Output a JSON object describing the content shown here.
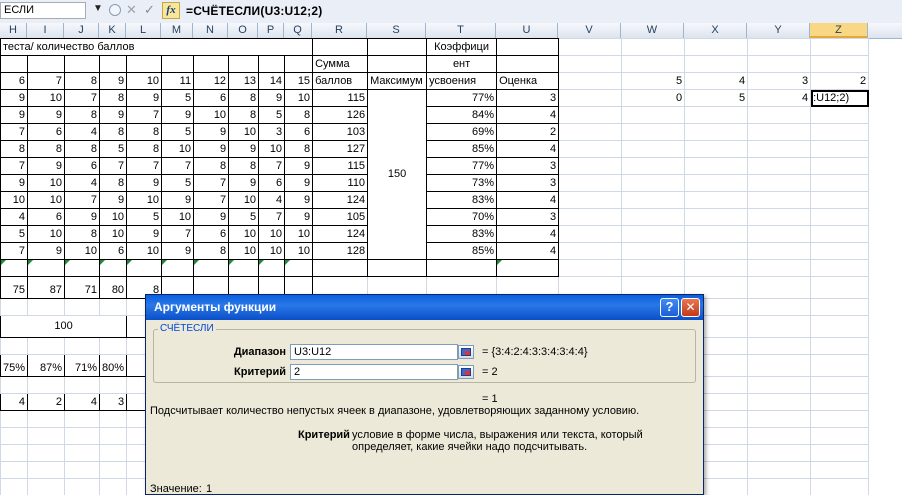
{
  "formula_bar": {
    "name_box": "ЕСЛИ",
    "formula": "=СЧЁТЕСЛИ(U3:U12;2)",
    "fx_label": "fx",
    "cancel_glyph": "✕",
    "enter_glyph": "✓"
  },
  "columns": [
    "H",
    "I",
    "J",
    "K",
    "L",
    "M",
    "N",
    "O",
    "P",
    "Q",
    "R",
    "S",
    "T",
    "U",
    "V",
    "W",
    "X",
    "Y",
    "Z"
  ],
  "selected_column": "Z",
  "sheet": {
    "header_text": "теста/ количество баллов",
    "numbers_row": [
      "6",
      "7",
      "8",
      "9",
      "10",
      "11",
      "12",
      "13",
      "14",
      "15"
    ],
    "sum_header_top": "Сумма",
    "sum_header_bottom": "баллов",
    "max_header": "Максимум",
    "coef_header_lines": [
      "Коэффици",
      "ент",
      "усвоения"
    ],
    "grade_header": "Оценка",
    "max_value": "150",
    "side_row1": [
      "5",
      "4",
      "3",
      "2"
    ],
    "side_row2": [
      "0",
      "5",
      "4",
      ":U12;2)"
    ],
    "data_rows": [
      {
        "scores": [
          "9",
          "10",
          "7",
          "8",
          "9",
          "5",
          "6",
          "8",
          "9",
          "10"
        ],
        "sum": "115",
        "coef": "77%",
        "grade": "3"
      },
      {
        "scores": [
          "9",
          "9",
          "8",
          "9",
          "7",
          "9",
          "10",
          "8",
          "5",
          "8"
        ],
        "sum": "126",
        "coef": "84%",
        "grade": "4"
      },
      {
        "scores": [
          "7",
          "6",
          "4",
          "8",
          "8",
          "5",
          "9",
          "10",
          "3",
          "6"
        ],
        "sum": "103",
        "coef": "69%",
        "grade": "2"
      },
      {
        "scores": [
          "8",
          "8",
          "8",
          "5",
          "8",
          "10",
          "9",
          "9",
          "10",
          "8"
        ],
        "sum": "127",
        "coef": "85%",
        "grade": "4"
      },
      {
        "scores": [
          "7",
          "9",
          "6",
          "7",
          "7",
          "7",
          "8",
          "8",
          "7",
          "9"
        ],
        "sum": "115",
        "coef": "77%",
        "grade": "3"
      },
      {
        "scores": [
          "9",
          "10",
          "4",
          "8",
          "9",
          "5",
          "7",
          "9",
          "6",
          "9"
        ],
        "sum": "110",
        "coef": "73%",
        "grade": "3"
      },
      {
        "scores": [
          "10",
          "10",
          "7",
          "9",
          "10",
          "9",
          "7",
          "10",
          "4",
          "9"
        ],
        "sum": "124",
        "coef": "83%",
        "grade": "4"
      },
      {
        "scores": [
          "4",
          "6",
          "9",
          "10",
          "5",
          "10",
          "9",
          "5",
          "7",
          "9"
        ],
        "sum": "105",
        "coef": "70%",
        "grade": "3"
      },
      {
        "scores": [
          "5",
          "10",
          "8",
          "10",
          "9",
          "7",
          "6",
          "10",
          "10",
          "10"
        ],
        "sum": "124",
        "coef": "83%",
        "grade": "4"
      },
      {
        "scores": [
          "7",
          "9",
          "10",
          "6",
          "10",
          "9",
          "8",
          "10",
          "10",
          "10"
        ],
        "sum": "128",
        "coef": "85%",
        "grade": "4"
      }
    ],
    "totals_row": [
      "75",
      "87",
      "71",
      "80",
      "8"
    ],
    "hundred": "100",
    "percent_row": [
      "75%",
      "87%",
      "71%",
      "80%",
      "8"
    ],
    "count_row": [
      "4",
      "2",
      "4",
      "3"
    ]
  },
  "dialog": {
    "title": "Аргументы функции",
    "help_glyph": "?",
    "close_glyph": "✕",
    "function_name": "СЧЁТЕСЛИ",
    "arg1_label": "Диапазон",
    "arg1_value": "U3:U12",
    "arg1_result": "= {3:4:2:4:3:3:4:3:4:4}",
    "arg2_label": "Критерий",
    "arg2_value": "2",
    "arg2_result": "= 2",
    "total_result": "= 1",
    "description": "Подсчитывает количество непустых ячеек в диапазоне, удовлетворяющих заданному условию.",
    "help_arg_name": "Критерий",
    "help_arg_text_1": "условие в форме числа, выражения или текста, который",
    "help_arg_text_2": "определяет, какие ячейки надо подсчитывать.",
    "value_label": "Значение:",
    "value": "1"
  }
}
